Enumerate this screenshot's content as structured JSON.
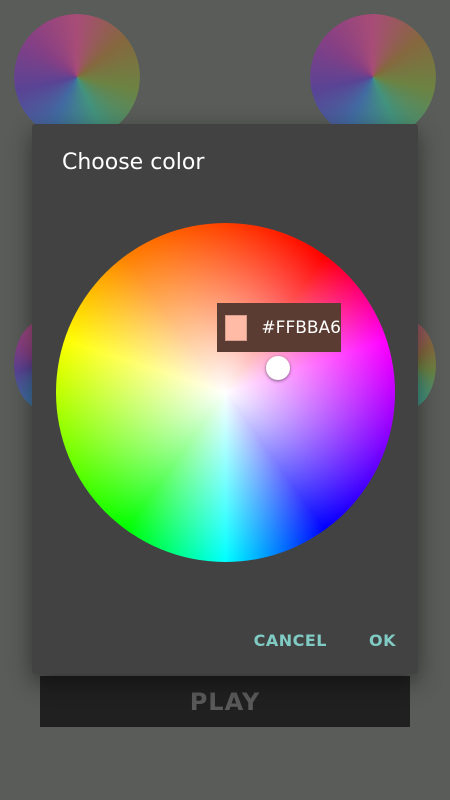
{
  "app": {
    "play_label": "PLAY"
  },
  "dialog": {
    "title": "Choose color",
    "selected_color": {
      "hex_label": "#FFBBA6",
      "swatch_color": "#FFBBA6"
    },
    "buttons": {
      "cancel": "CANCEL",
      "ok": "OK"
    },
    "accent_color": "#80cbc4"
  }
}
